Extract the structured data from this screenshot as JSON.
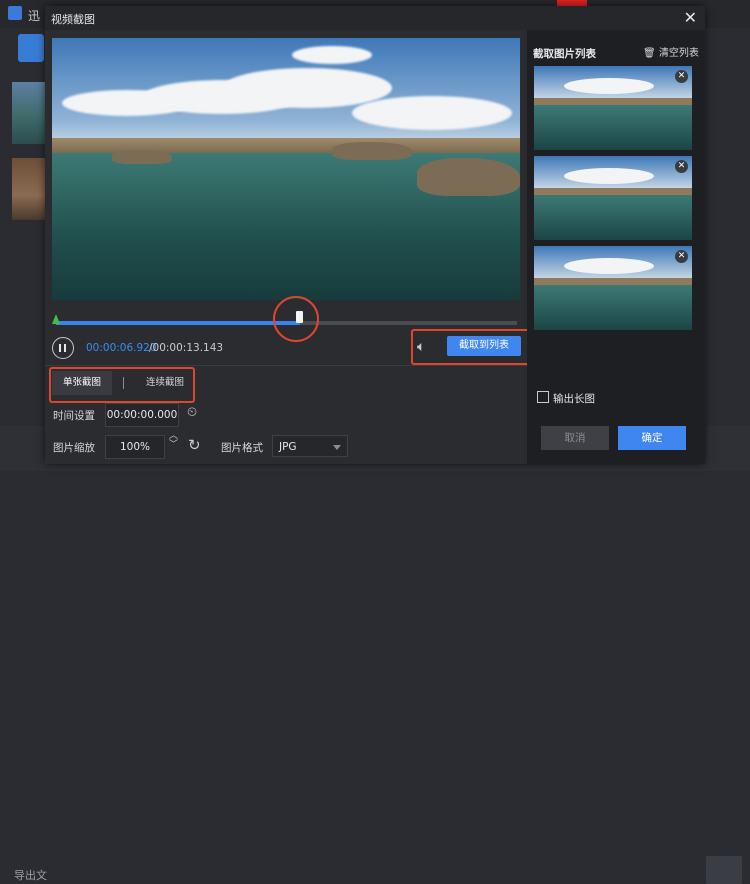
{
  "app": {
    "title": "迅",
    "export_label": "导出文"
  },
  "dialog": {
    "title": "视频截图"
  },
  "player": {
    "current_time": "00:00:06.920",
    "total_time": "/00:00:13.143",
    "progress": 0.53,
    "capture_button": "截取到列表"
  },
  "tabs": {
    "single": "单张截图",
    "continuous": "连续截图"
  },
  "settings": {
    "time_label": "时间设置",
    "time_value": "00:00:00.000",
    "zoom_label": "图片缩放",
    "zoom_value": "100%",
    "format_label": "图片格式",
    "format_value": "JPG"
  },
  "list": {
    "title": "截取图片列表",
    "clear": "清空列表",
    "count": 3,
    "output_long": "输出长图"
  },
  "buttons": {
    "cancel": "取消",
    "confirm": "确定"
  },
  "icons": {
    "close": "close-icon",
    "pause": "pause-icon",
    "volume": "volume-icon",
    "trash": "trash-icon",
    "reset_time": "reset-time-icon",
    "stepper": "stepper-icon",
    "reset_zoom": "reset-zoom-icon",
    "thumb_close": "remove-thumb-icon"
  },
  "colors": {
    "accent": "#3f86f0",
    "highlight": "#e0462e",
    "start_marker": "#3fbf4a"
  }
}
